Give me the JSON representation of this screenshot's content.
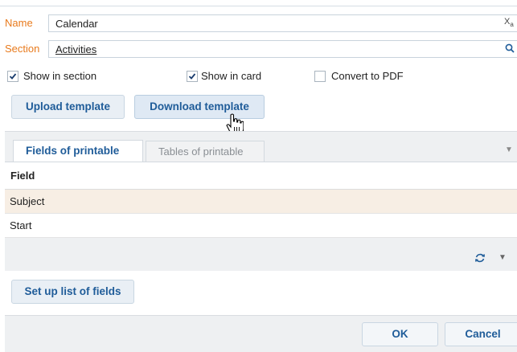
{
  "form": {
    "name": {
      "label": "Name",
      "value": "Calendar",
      "icon": "translate-icon"
    },
    "section": {
      "label": "Section",
      "value": "Activities",
      "icon": "search-icon"
    }
  },
  "checkboxes": {
    "show_in_section": {
      "label": "Show in section",
      "checked": true
    },
    "show_in_card": {
      "label": "Show in card",
      "checked": true
    },
    "convert_to_pdf": {
      "label": "Convert to PDF",
      "checked": false
    }
  },
  "buttons": {
    "upload": "Upload template",
    "download": "Download template",
    "setup_fields": "Set up list of fields",
    "ok": "OK",
    "cancel": "Cancel"
  },
  "tabs": [
    {
      "label": "Fields of printable",
      "active": true
    },
    {
      "label": "Tables of printable",
      "active": false
    }
  ],
  "grid": {
    "header": "Field",
    "rows": [
      "Subject",
      "Start"
    ]
  },
  "colors": {
    "label_orange": "#e87a1c",
    "accent_blue": "#1f5c99",
    "selected_row": "#f7eee4"
  }
}
